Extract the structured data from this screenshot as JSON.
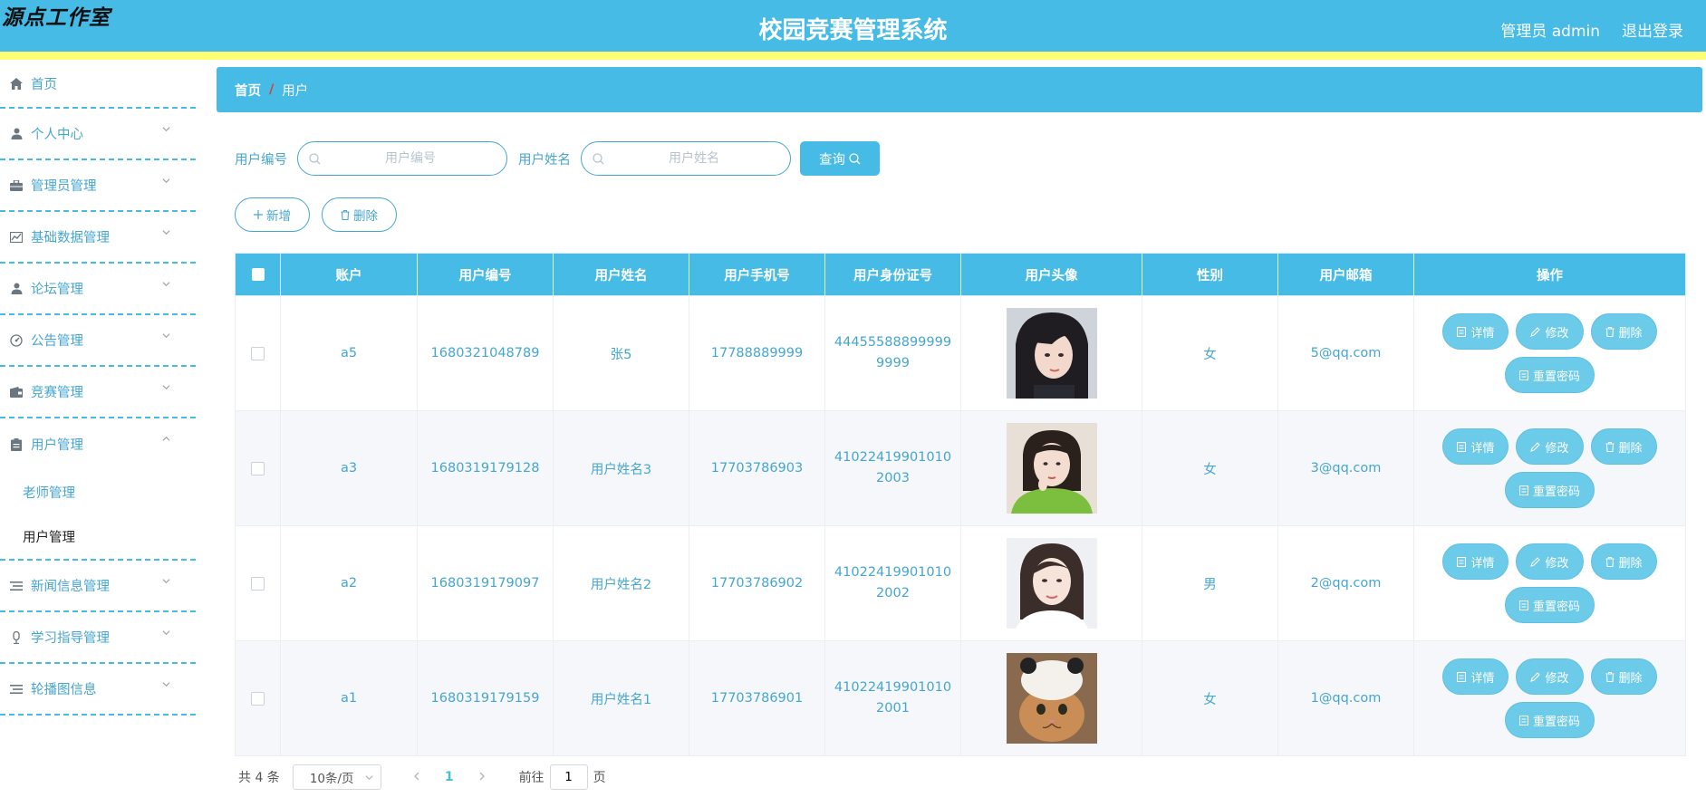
{
  "header": {
    "brand": "源点工作室",
    "title": "校园竞赛管理系统",
    "user_label": "管理员 admin",
    "logout_label": "退出登录"
  },
  "sidebar": {
    "home": "首页",
    "items": [
      {
        "label": "个人中心",
        "icon": "person-icon"
      },
      {
        "label": "管理员管理",
        "icon": "briefcase-icon"
      },
      {
        "label": "基础数据管理",
        "icon": "chart-icon"
      },
      {
        "label": "论坛管理",
        "icon": "person-icon"
      },
      {
        "label": "公告管理",
        "icon": "gauge-icon"
      },
      {
        "label": "竞赛管理",
        "icon": "wallet-icon"
      },
      {
        "label": "用户管理",
        "icon": "clipboard-icon"
      },
      {
        "label": "新闻信息管理",
        "icon": "list-icon"
      },
      {
        "label": "学习指导管理",
        "icon": "mic-icon"
      },
      {
        "label": "轮播图信息",
        "icon": "list-icon"
      }
    ],
    "sub_items": [
      "老师管理",
      "用户管理"
    ]
  },
  "breadcrumb": {
    "home": "首页",
    "sep": "/",
    "current": "用户"
  },
  "search": {
    "label1": "用户编号",
    "placeholder1": "用户编号",
    "label2": "用户姓名",
    "placeholder2": "用户姓名",
    "query_label": "查询"
  },
  "actions": {
    "add_label": "新增",
    "delete_label": "删除"
  },
  "table": {
    "columns": [
      "账户",
      "用户编号",
      "用户姓名",
      "用户手机号",
      "用户身份证号",
      "用户头像",
      "性别",
      "用户邮箱",
      "操作"
    ],
    "rows": [
      {
        "account": "a5",
        "no": "1680321048789",
        "name": "张5",
        "phone": "17788889999",
        "idcard": "444555888999999999",
        "avatar": "girl-portrait-dark-hair",
        "gender": "女",
        "email": "5@qq.com"
      },
      {
        "account": "a3",
        "no": "1680319179128",
        "name": "用户姓名3",
        "phone": "17703786903",
        "idcard": "410224199010102003",
        "avatar": "girl-portrait-green-sweater",
        "gender": "女",
        "email": "3@qq.com"
      },
      {
        "account": "a2",
        "no": "1680319179097",
        "name": "用户姓名2",
        "phone": "17703786902",
        "idcard": "410224199010102002",
        "avatar": "woman-portrait-light",
        "gender": "男",
        "email": "2@qq.com"
      },
      {
        "account": "a1",
        "no": "1680319179159",
        "name": "用户姓名1",
        "phone": "17703786901",
        "idcard": "410224199010102001",
        "avatar": "cat-with-panda-hat",
        "gender": "女",
        "email": "1@qq.com"
      }
    ],
    "op_labels": {
      "detail": "详情",
      "edit": "修改",
      "delete": "删除",
      "reset": "重置密码"
    }
  },
  "pagination": {
    "total": "共 4 条",
    "page_size": "10条/页",
    "current_page": "1",
    "goto_label": "前往",
    "goto_value": "1",
    "page_suffix": "页"
  },
  "colors": {
    "primary": "#46bbe6",
    "stripe": "#ffff75",
    "text_link": "#46a6d0"
  }
}
